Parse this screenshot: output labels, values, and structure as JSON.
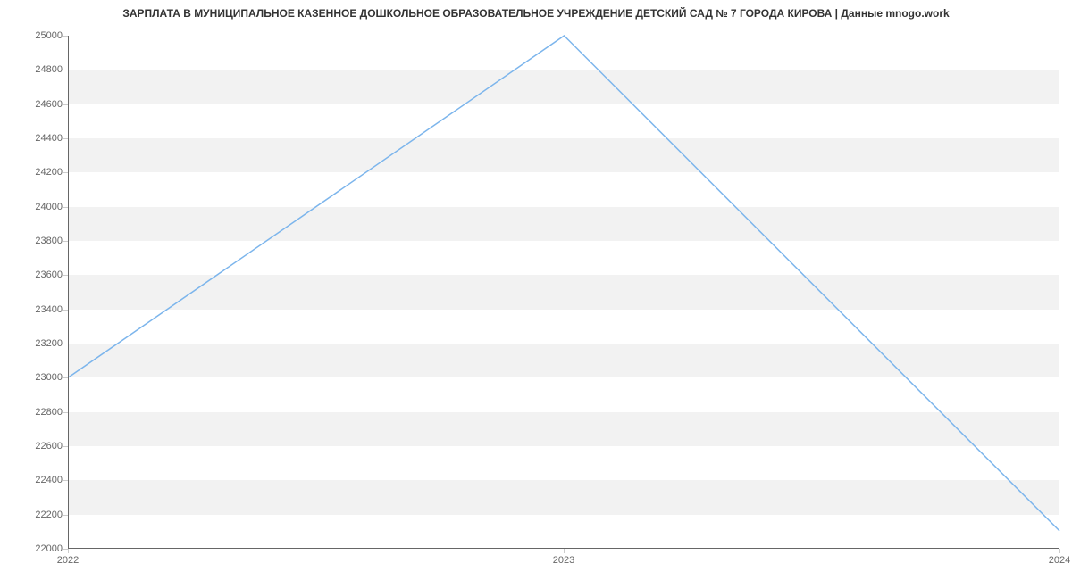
{
  "chart_data": {
    "type": "line",
    "title": "ЗАРПЛАТА В МУНИЦИПАЛЬНОЕ КАЗЕННОЕ ДОШКОЛЬНОЕ ОБРАЗОВАТЕЛЬНОЕ УЧРЕЖДЕНИЕ ДЕТСКИЙ САД № 7 ГОРОДА КИРОВА | Данные mnogo.work",
    "x": [
      2022,
      2023,
      2024
    ],
    "values": [
      23000,
      25000,
      22100
    ],
    "xlabel": "",
    "ylabel": "",
    "ylim": [
      22000,
      25000
    ],
    "xlim": [
      2022,
      2024
    ],
    "y_ticks": [
      22000,
      22200,
      22400,
      22600,
      22800,
      23000,
      23200,
      23400,
      23600,
      23800,
      24000,
      24200,
      24400,
      24600,
      24800,
      25000
    ],
    "x_ticks": [
      2022,
      2023,
      2024
    ],
    "line_color": "#7cb5ec"
  }
}
